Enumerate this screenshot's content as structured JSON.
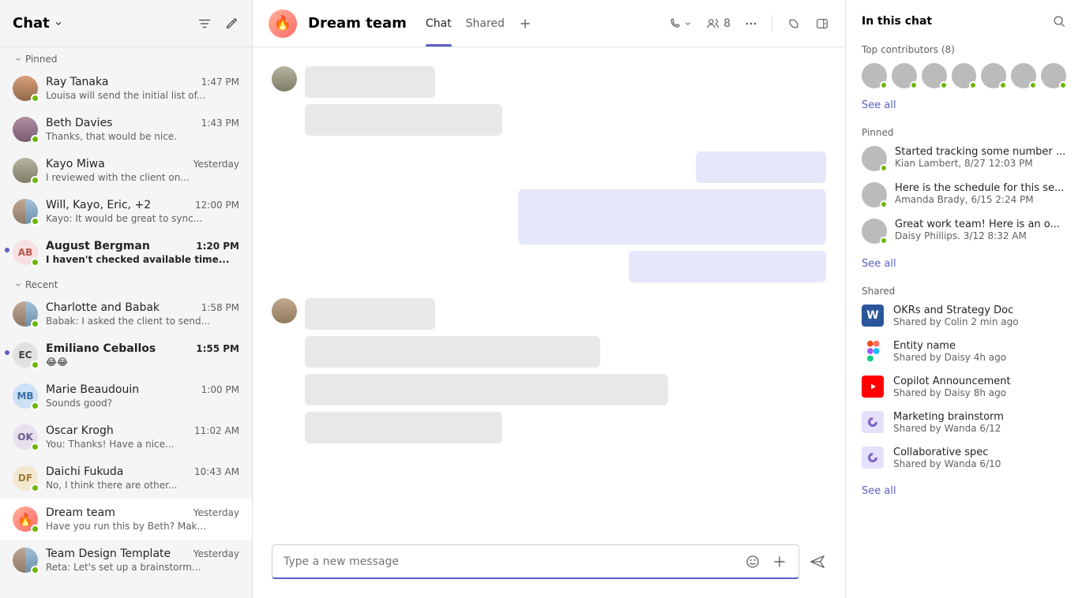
{
  "left": {
    "title": "Chat",
    "sections": {
      "pinned_label": "Pinned",
      "recent_label": "Recent"
    },
    "pinned": [
      {
        "name": "Ray Tanaka",
        "time": "1:47 PM",
        "preview": "Louisa will send the initial list of...",
        "avatar": "img",
        "avatarClass": "av1"
      },
      {
        "name": "Beth Davies",
        "time": "1:43 PM",
        "preview": "Thanks, that would be nice.",
        "avatar": "img",
        "avatarClass": "av2"
      },
      {
        "name": "Kayo Miwa",
        "time": "Yesterday",
        "preview": "I reviewed with the client on...",
        "avatar": "img",
        "avatarClass": "av3"
      },
      {
        "name": "Will, Kayo, Eric, +2",
        "time": "12:00 PM",
        "preview": "Kayo: It would be great to sync...",
        "avatar": "duo"
      },
      {
        "name": "August Bergman",
        "time": "1:20 PM",
        "preview": "I haven't checked available time...",
        "avatar": "initials",
        "initials": "AB",
        "avatarClass": "initials-ab",
        "bold": true,
        "unread": true
      }
    ],
    "recent": [
      {
        "name": "Charlotte and Babak",
        "time": "1:58 PM",
        "preview": "Babak: I asked the client to send...",
        "avatar": "duo"
      },
      {
        "name": "Emiliano Ceballos",
        "time": "1:55 PM",
        "preview": "😂😂",
        "avatar": "initials",
        "initials": "EC",
        "avatarClass": "initials-ec",
        "bold": true,
        "unread": true
      },
      {
        "name": "Marie Beaudouin",
        "time": "1:00 PM",
        "preview": "Sounds good?",
        "avatar": "initials",
        "initials": "MB",
        "avatarClass": "initials-mb"
      },
      {
        "name": "Oscar Krogh",
        "time": "11:02 AM",
        "preview": "You: Thanks! Have a nice...",
        "avatar": "initials",
        "initials": "OK",
        "avatarClass": "initials-ok"
      },
      {
        "name": "Daichi Fukuda",
        "time": "10:43 AM",
        "preview": "No, I think there are other...",
        "avatar": "initials",
        "initials": "DF",
        "avatarClass": "initials-df"
      },
      {
        "name": "Dream team",
        "time": "Yesterday",
        "preview": "Have you run this by Beth? Mak...",
        "avatar": "fire",
        "selected": true
      },
      {
        "name": "Team Design Template",
        "time": "Yesterday",
        "preview": "Reta: Let's set up a brainstorm...",
        "avatar": "duo"
      }
    ]
  },
  "header": {
    "title": "Dream team",
    "tabs": {
      "chat": "Chat",
      "shared": "Shared"
    },
    "participants_count": "8"
  },
  "compose": {
    "placeholder": "Type a new message"
  },
  "right": {
    "title": "In this chat",
    "contributors_label": "Top contributors (8)",
    "see_all": "See all",
    "pinned_label": "Pinned",
    "pinned": [
      {
        "title": "Started tracking some number ...",
        "meta": "Kian Lambert, 8/27 12:03 PM",
        "avatarClass": "av4"
      },
      {
        "title": "Here is the schedule for this se...",
        "meta": "Amanda Brady, 6/15 2:24 PM",
        "avatarClass": "av5"
      },
      {
        "title": "Great work team! Here is an o...",
        "meta": "Daisy Phillips. 3/12 8:32 AM",
        "avatarClass": "av7"
      }
    ],
    "shared_label": "Shared",
    "shared": [
      {
        "icon": "word",
        "title": "OKRs and Strategy Doc",
        "meta": "Shared by Colin 2 min ago"
      },
      {
        "icon": "figma",
        "title": "Entity name",
        "meta": "Shared by Daisy 4h ago"
      },
      {
        "icon": "yt",
        "title": "Copilot Announcement",
        "meta": "Shared by Daisy 8h ago"
      },
      {
        "icon": "loop",
        "title": "Marketing brainstorm",
        "meta": "Shared by Wanda 6/12"
      },
      {
        "icon": "loop",
        "title": "Collaborative spec",
        "meta": "Shared by Wanda 6/10"
      }
    ]
  },
  "message_widths": {
    "g1": [
      165,
      250
    ],
    "g2": [
      165,
      390,
      250
    ],
    "g3": [
      165,
      374,
      460,
      250
    ]
  }
}
